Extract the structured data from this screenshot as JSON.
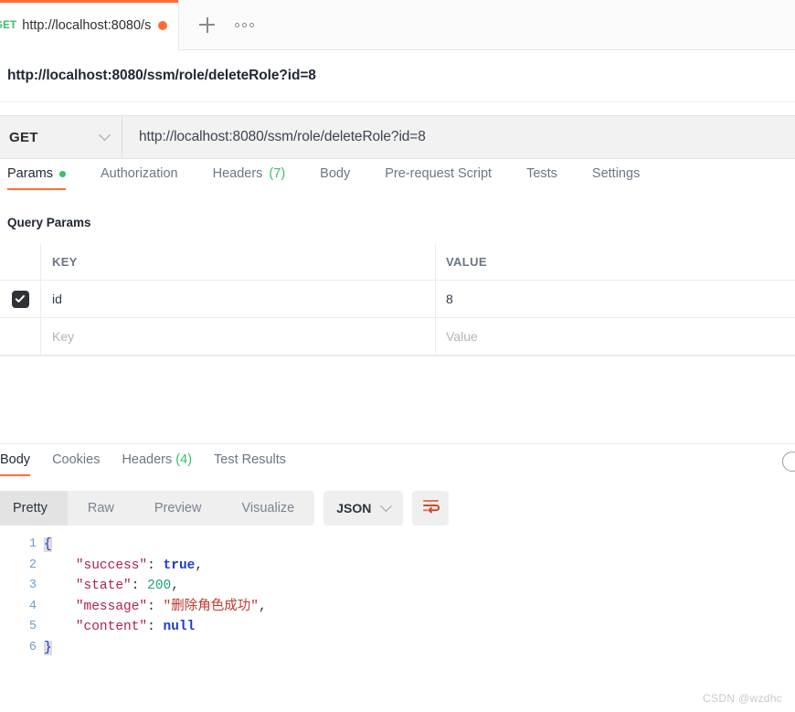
{
  "tabstrip": {
    "request_tab": {
      "method": "GET",
      "name": "http://localhost:8080/s",
      "unsaved_dot": "unsaved-indicator"
    },
    "new_tab_label": "+",
    "more_label": "•••"
  },
  "request": {
    "title": "http://localhost:8080/ssm/role/deleteRole?id=8",
    "method": "GET",
    "url": "http://localhost:8080/ssm/role/deleteRole?id=8",
    "tabs": [
      {
        "label": "Params",
        "count": "",
        "active": true,
        "dot": true
      },
      {
        "label": "Authorization",
        "count": "",
        "active": false,
        "dot": false
      },
      {
        "label": "Headers",
        "count": "(7)",
        "active": false,
        "dot": false
      },
      {
        "label": "Body",
        "count": "",
        "active": false,
        "dot": false
      },
      {
        "label": "Pre-request Script",
        "count": "",
        "active": false,
        "dot": false
      },
      {
        "label": "Tests",
        "count": "",
        "active": false,
        "dot": false
      },
      {
        "label": "Settings",
        "count": "",
        "active": false,
        "dot": false
      }
    ],
    "query_params_label": "Query Params",
    "table": {
      "headers": {
        "key": "KEY",
        "value": "VALUE"
      },
      "rows": [
        {
          "checked": true,
          "key": "id",
          "value": "8"
        }
      ],
      "placeholder_row": {
        "key": "Key",
        "value": "Value"
      }
    }
  },
  "response": {
    "tabs": [
      {
        "label": "Body",
        "count": "",
        "active": true
      },
      {
        "label": "Cookies",
        "count": "",
        "active": false
      },
      {
        "label": "Headers",
        "count": "(4)",
        "active": false
      },
      {
        "label": "Test Results",
        "count": "",
        "active": false
      }
    ],
    "view_modes": [
      {
        "label": "Pretty",
        "active": true
      },
      {
        "label": "Raw",
        "active": false
      },
      {
        "label": "Preview",
        "active": false
      },
      {
        "label": "Visualize",
        "active": false
      }
    ],
    "format": "JSON",
    "wrap_icon": "word-wrap-icon",
    "info_icon": "info-circle-icon",
    "body_lines": [
      {
        "no": "1",
        "indent": 0,
        "parts": [
          {
            "t": "brace",
            "v": "{"
          }
        ]
      },
      {
        "no": "2",
        "indent": 1,
        "parts": [
          {
            "t": "key",
            "v": "\"success\""
          },
          {
            "t": "punct",
            "v": ": "
          },
          {
            "t": "bool",
            "v": "true"
          },
          {
            "t": "punct",
            "v": ","
          }
        ]
      },
      {
        "no": "3",
        "indent": 1,
        "parts": [
          {
            "t": "key",
            "v": "\"state\""
          },
          {
            "t": "punct",
            "v": ": "
          },
          {
            "t": "num",
            "v": "200"
          },
          {
            "t": "punct",
            "v": ","
          }
        ]
      },
      {
        "no": "4",
        "indent": 1,
        "parts": [
          {
            "t": "key",
            "v": "\"message\""
          },
          {
            "t": "punct",
            "v": ": "
          },
          {
            "t": "str",
            "v": "\"删除角色成功\""
          },
          {
            "t": "punct",
            "v": ","
          }
        ]
      },
      {
        "no": "5",
        "indent": 1,
        "parts": [
          {
            "t": "key",
            "v": "\"content\""
          },
          {
            "t": "punct",
            "v": ": "
          },
          {
            "t": "bool",
            "v": "null"
          }
        ]
      },
      {
        "no": "6",
        "indent": 0,
        "parts": [
          {
            "t": "brace",
            "v": "}"
          }
        ]
      }
    ]
  },
  "watermark": "CSDN @wzdhc",
  "colors": {
    "accent": "#ff6c37",
    "green": "#3dbb6d",
    "text": "#1f2733",
    "muted": "#6b7684"
  }
}
